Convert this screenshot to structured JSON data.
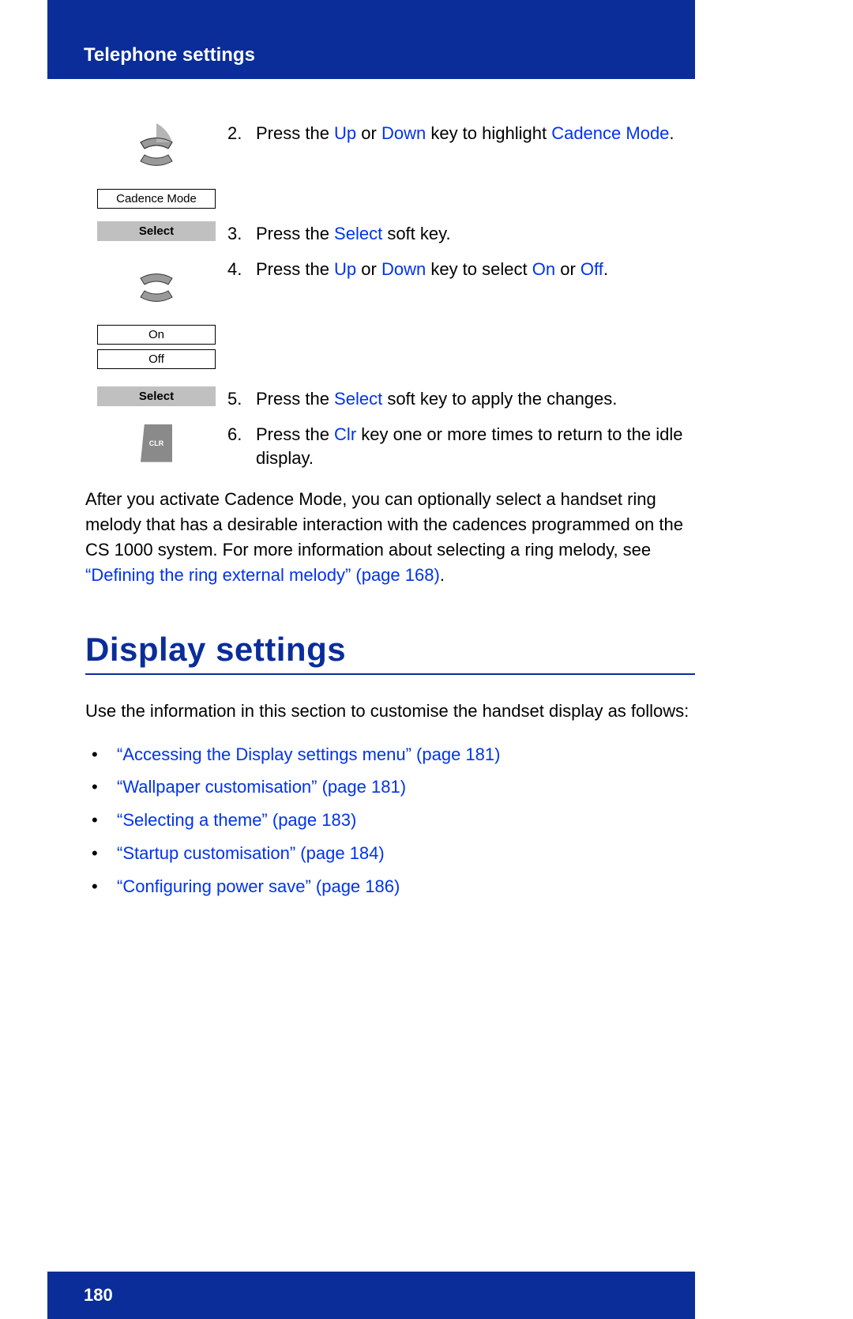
{
  "header": {
    "title": "Telephone settings"
  },
  "steps": {
    "s2": {
      "num": "2.",
      "pre": "Press the ",
      "up": "Up",
      "mid1": " or ",
      "down": "Down",
      "mid2": " key to highlight ",
      "target": "Cadence Mode",
      "post": "."
    },
    "box_cadence": "Cadence Mode",
    "box_select1": "Select",
    "s3": {
      "num": "3.",
      "pre": "Press the ",
      "select": "Select",
      "post": " soft key."
    },
    "s4": {
      "num": "4.",
      "pre": "Press the ",
      "up": "Up",
      "mid1": " or ",
      "down": "Down",
      "mid2": " key to select ",
      "on": "On",
      "mid3": " or ",
      "off": "Off",
      "post": "."
    },
    "box_on": "On",
    "box_off": "Off",
    "box_select2": "Select",
    "s5": {
      "num": "5.",
      "pre": "Press the ",
      "select": "Select",
      "post": " soft key to apply the changes."
    },
    "s6": {
      "num": "6.",
      "pre": "Press the ",
      "clr": "Clr",
      "post": " key one or more times to return to the idle display."
    },
    "clr_label": "CLR"
  },
  "para1": {
    "text": "After you activate Cadence Mode, you can optionally select a handset ring melody that has a desirable interaction with the cadences programmed on the CS 1000 system. For more information about selecting a ring melody, see ",
    "link": "“Defining the ring external melody” (page 168)",
    "post": "."
  },
  "section": {
    "heading": "Display settings"
  },
  "para2": {
    "text": "Use the information in this section to customise the handset display as follows:"
  },
  "bullets": [
    "“Accessing the Display settings menu” (page 181)",
    "“Wallpaper customisation” (page 181)",
    "“Selecting a theme” (page 183)",
    "“Startup customisation” (page 184)",
    "“Configuring power save” (page 186)"
  ],
  "footer": {
    "page": "180"
  }
}
